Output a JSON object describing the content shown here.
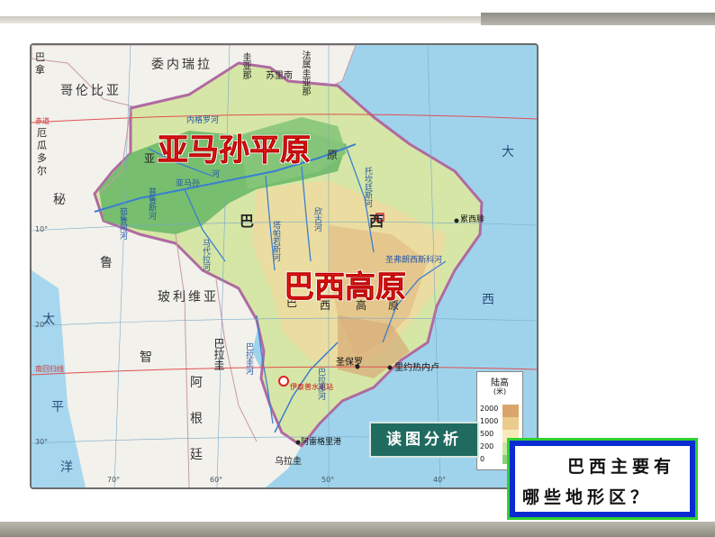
{
  "map": {
    "regions": {
      "amazon_plain": "亚马孙平原",
      "brazil_plateau": "巴西高原"
    },
    "countries": {
      "venezuela": "委内瑞拉",
      "colombia": "哥伦比亚",
      "guyana": "圭亚那",
      "suriname": "苏里南",
      "french_guiana": "法属圭亚那",
      "bolivia": "玻利维亚",
      "paraguay": "巴拉圭",
      "argentina_1": "阿",
      "argentina_2": "根",
      "argentina_3": "廷",
      "uruguay": "乌拉圭",
      "chile": "智",
      "panama_1": "巴",
      "panama_2": "拿",
      "ecuador_1": "厄",
      "ecuador_2": "瓜",
      "ecuador_3": "多",
      "ecuador_4": "尔",
      "peru": "秘",
      "peru_2": "鲁"
    },
    "brazil_name": {
      "ba": "巴",
      "xi": "西"
    },
    "small_labels": {
      "ya": "亚",
      "yuan": "原",
      "plateau_ba": "巴",
      "plateau_xi": "西",
      "plateau_gao": "高",
      "plateau_yuan": "原"
    },
    "oceans": {
      "atlantic_1": "大",
      "atlantic_2": "西",
      "pacific_1": "太",
      "pacific_2": "平",
      "pacific_3": "洋"
    },
    "cities": {
      "sao_paulo": "圣保罗",
      "rio": "里约热内卢",
      "itaipu": "伊泰普水电站",
      "porto_alegre": "阿雷格里港",
      "recife": "累西腓"
    },
    "rivers": {
      "amazon": "亚马孙",
      "amazon_2": "河",
      "sao_francisco": "圣弗朗西斯科河",
      "parana": "巴拉那河",
      "negro": "内格罗河",
      "madeira": "马代拉河",
      "tocantins": "托坎廷斯河",
      "xingu": "欣古河",
      "tapajos": "塔帕若斯河",
      "paraguay_river": "巴拉圭河",
      "purus": "普鲁斯河",
      "jurua": "茹鲁阿河"
    },
    "coords": {
      "lat_10": "10°",
      "lat_20": "20°",
      "lat_30": "30°",
      "equator": "赤道",
      "tropic": "南回归线",
      "lon_70": "70°",
      "lon_60": "60°",
      "lon_50": "50°",
      "lon_40": "40°"
    },
    "legend": {
      "title": "陆高",
      "unit": "(米)",
      "ticks": [
        "2000",
        "1000",
        "500",
        "200",
        "0"
      ],
      "colors": [
        "#d9a56b",
        "#eccb8e",
        "#f6ebb8",
        "#c8e6a6",
        "#8fcf7c"
      ]
    }
  },
  "read_button": "读图分析",
  "question": {
    "line1": "巴西主要有",
    "line2": "哪些地形区？"
  }
}
